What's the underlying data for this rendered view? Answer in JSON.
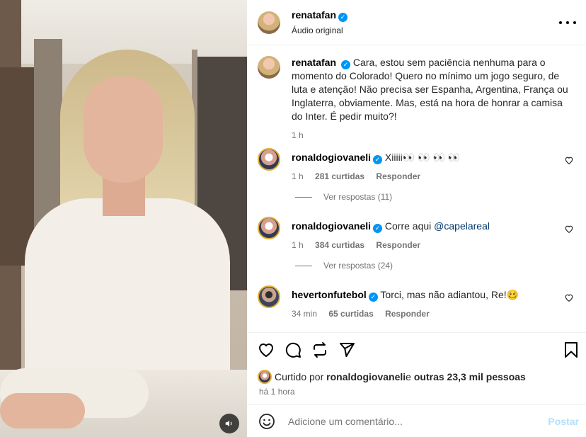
{
  "post": {
    "username": "renatafan",
    "audio": "Áudio original",
    "verified_mark": "✓"
  },
  "caption": {
    "username": "renatafan",
    "text": "Cara, estou sem paciência nenhuma para o momento do Colorado! Quero no mínimo um jogo seguro, de luta e atenção! Não precisa ser Espanha, Argentina, França ou Inglaterra, obviamente. Mas, está na hora de honrar a camisa do Inter. É pedir muito?!",
    "time": "1 h"
  },
  "comments": [
    {
      "username": "ronaldogiovaneli",
      "text": "Xiiiii👀 👀 👀 👀",
      "time": "1 h",
      "likes": "281 curtidas",
      "reply": "Responder",
      "view_replies": "Ver respostas (11)"
    },
    {
      "username": "ronaldogiovaneli",
      "text_before": "Corre aqui ",
      "mention": "@capelareal",
      "time": "1 h",
      "likes": "384 curtidas",
      "reply": "Responder",
      "view_replies": "Ver respostas (24)"
    },
    {
      "username": "hevertonfutebol",
      "text": "Torci, mas não adiantou, Re!🥴",
      "time": "34 min",
      "likes": "65 curtidas",
      "reply": "Responder"
    }
  ],
  "likes_line": {
    "prefix": "Curtido por ",
    "user": "ronaldogiovaneli",
    "middle": " e ",
    "others": "outras 23,3 mil pessoas"
  },
  "time_ago": "há 1 hora",
  "add_comment": {
    "placeholder": "Adicione um comentário...",
    "post_label": "Postar"
  },
  "colors": {
    "accent": "#0095f6",
    "post_disabled": "#b2dffc",
    "mention": "#00376b"
  }
}
